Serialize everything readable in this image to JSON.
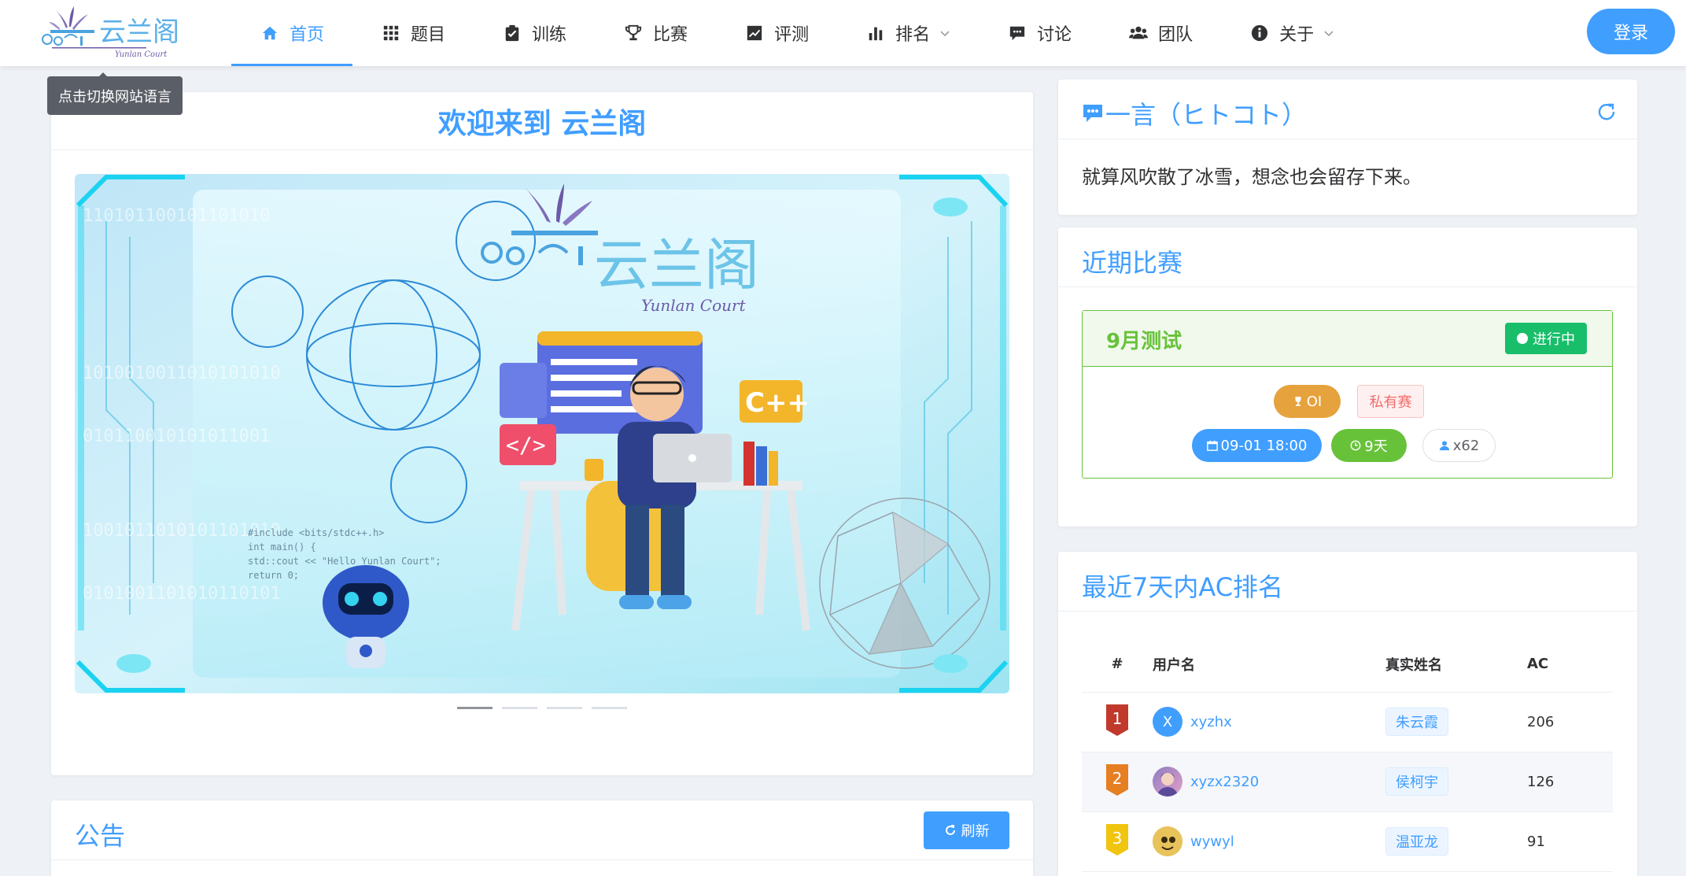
{
  "header": {
    "logo": {
      "cn": "云兰阁",
      "en": "Yunlan Court"
    },
    "nav": [
      {
        "label": "首页",
        "icon": "home-icon",
        "active": true
      },
      {
        "label": "题目",
        "icon": "grid-icon"
      },
      {
        "label": "训练",
        "icon": "clipboard-check-icon"
      },
      {
        "label": "比赛",
        "icon": "trophy-icon"
      },
      {
        "label": "评测",
        "icon": "line-chart-icon"
      },
      {
        "label": "排名",
        "icon": "bar-chart-icon",
        "dropdown": true
      },
      {
        "label": "讨论",
        "icon": "comment-icon"
      },
      {
        "label": "团队",
        "icon": "users-icon"
      },
      {
        "label": "关于",
        "icon": "info-icon",
        "dropdown": true
      }
    ],
    "login_label": "登录",
    "language_tooltip": "点击切换网站语言"
  },
  "welcome": {
    "title": "欢迎来到 云兰阁",
    "banner": {
      "logo_cn": "云兰阁",
      "logo_en": "Yunlan Court",
      "badge_cpp": "C++",
      "code_lines": [
        "#include <bits/stdc++.h>",
        "int main() {",
        "  std::cout << \"Hello Yunlan Court\";",
        "  return 0;"
      ]
    },
    "carousel_count": 4,
    "carousel_active": 0
  },
  "notice": {
    "title": "公告",
    "refresh_label": "刷新"
  },
  "hitokoto": {
    "title": "一言（ヒトコト）",
    "text": "就算风吹散了冰雪，想念也会留存下来。"
  },
  "contests": {
    "title": "近期比赛",
    "items": [
      {
        "name": "9月测试",
        "status": "进行中",
        "type": "OI",
        "auth": "私有赛",
        "start": "09-01 18:00",
        "duration": "9天",
        "participants": "x62"
      }
    ]
  },
  "ranking": {
    "title": "最近7天内AC排名",
    "columns": [
      "#",
      "用户名",
      "真实姓名",
      "AC"
    ],
    "rows": [
      {
        "rank": "1",
        "username": "xyzhx",
        "realname": "朱云霞",
        "ac": "206",
        "avatar_letter": "X",
        "badge_color": "#c0392b"
      },
      {
        "rank": "2",
        "username": "xyzx2320",
        "realname": "侯柯宇",
        "ac": "126",
        "avatar_letter": "",
        "badge_color": "#e67e22"
      },
      {
        "rank": "3",
        "username": "wywyl",
        "realname": "温亚龙",
        "ac": "91",
        "avatar_letter": "",
        "badge_color": "#f1c40f"
      }
    ]
  },
  "colors": {
    "primary": "#409eff",
    "success": "#67c23a",
    "warning": "#e6a23c"
  }
}
